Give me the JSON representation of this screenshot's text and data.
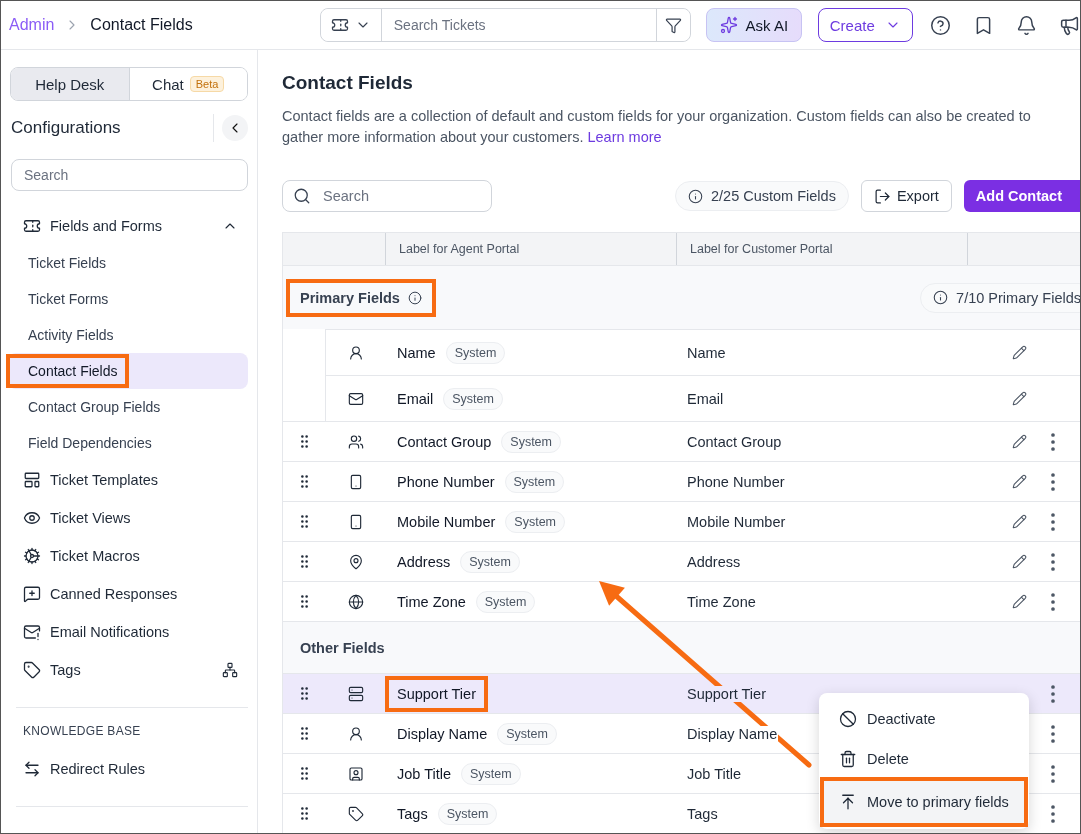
{
  "header": {
    "breadcrumb": [
      {
        "label": "Admin",
        "link": true
      },
      {
        "label": "Contact Fields",
        "link": false
      }
    ],
    "search": {
      "placeholder": "Search Tickets"
    },
    "ask_ai": "Ask AI",
    "create": "Create"
  },
  "sidebar": {
    "tabs": [
      {
        "label": "Help Desk",
        "selected": true
      },
      {
        "label": "Chat",
        "badge": "Beta",
        "selected": false
      }
    ],
    "title": "Configurations",
    "search": {
      "placeholder": "Search"
    },
    "items": [
      {
        "label": "Fields and Forms",
        "expanded": true,
        "children": [
          {
            "label": "Ticket Fields",
            "selected": false,
            "highlighted": false
          },
          {
            "label": "Ticket Forms",
            "selected": false,
            "highlighted": false
          },
          {
            "label": "Activity Fields",
            "selected": false,
            "highlighted": false
          },
          {
            "label": "Contact Fields",
            "selected": true,
            "highlighted": true
          },
          {
            "label": "Contact Group Fields",
            "selected": false,
            "highlighted": false
          },
          {
            "label": "Field Dependencies",
            "selected": false,
            "highlighted": false
          }
        ]
      },
      {
        "label": "Ticket Templates"
      },
      {
        "label": "Ticket Views"
      },
      {
        "label": "Ticket Macros"
      },
      {
        "label": "Canned Responses"
      },
      {
        "label": "Email Notifications"
      },
      {
        "label": "Tags"
      }
    ],
    "sections": [
      {
        "heading": "KNOWLEDGE BASE",
        "items": [
          {
            "label": "Redirect Rules"
          }
        ]
      }
    ]
  },
  "page": {
    "title": "Contact Fields",
    "description": "Contact fields are a collection of default and custom fields for your organization. Custom fields can also be created to gather more information about your customers.",
    "link": "Learn more",
    "search": {
      "placeholder": "Search"
    },
    "custom_count": "2/25 Custom Fields",
    "export": "Export",
    "add": "Add Contact"
  },
  "table": {
    "columns": [
      "Label for Agent Portal",
      "Label for Customer Portal"
    ],
    "sections": [
      {
        "title": "Primary Fields",
        "info": true,
        "count": "7/10 Primary Fields",
        "highlighted": true,
        "rows": [
          {
            "name": "Name",
            "tag": "System",
            "portal_label": "Name",
            "locked": true,
            "selected": false,
            "highlighted": false
          },
          {
            "name": "Email",
            "tag": "System",
            "portal_label": "Email",
            "locked": true,
            "selected": false,
            "highlighted": false
          },
          {
            "name": "Contact Group",
            "tag": "System",
            "portal_label": "Contact Group",
            "locked": false,
            "selected": false,
            "highlighted": false
          },
          {
            "name": "Phone Number",
            "tag": "System",
            "portal_label": "Phone Number",
            "locked": false,
            "selected": false,
            "highlighted": false
          },
          {
            "name": "Mobile Number",
            "tag": "System",
            "portal_label": "Mobile Number",
            "locked": false,
            "selected": false,
            "highlighted": false
          },
          {
            "name": "Address",
            "tag": "System",
            "portal_label": "Address",
            "locked": false,
            "selected": false,
            "highlighted": false
          },
          {
            "name": "Time Zone",
            "tag": "System",
            "portal_label": "Time Zone",
            "locked": false,
            "selected": false,
            "highlighted": false
          }
        ]
      },
      {
        "title": "Other Fields",
        "info": false,
        "highlighted": false,
        "rows": [
          {
            "name": "Support Tier",
            "portal_label": "Support Tier",
            "locked": false,
            "selected": true,
            "highlighted": true
          },
          {
            "name": "Display Name",
            "tag": "System",
            "portal_label": "Display Name",
            "locked": false,
            "selected": false,
            "highlighted": false
          },
          {
            "name": "Job Title",
            "tag": "System",
            "portal_label": "Job Title",
            "locked": false,
            "selected": false,
            "highlighted": false
          },
          {
            "name": "Tags",
            "tag": "System",
            "portal_label": "Tags",
            "locked": false,
            "selected": false,
            "highlighted": false
          }
        ]
      }
    ]
  },
  "menu": {
    "items": [
      {
        "label": "Deactivate",
        "highlighted": false
      },
      {
        "label": "Delete",
        "highlighted": false
      },
      {
        "label": "Move to primary fields",
        "highlighted": true
      }
    ]
  }
}
